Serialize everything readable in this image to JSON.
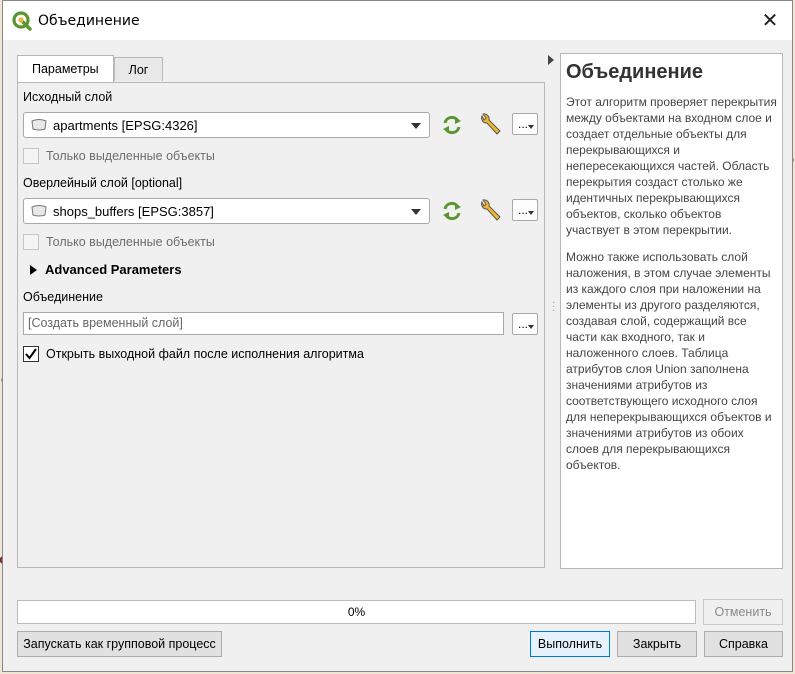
{
  "window": {
    "title": "Объединение"
  },
  "tabs": [
    {
      "label": "Параметры"
    },
    {
      "label": "Лог"
    }
  ],
  "params": {
    "input_label": "Исходный слой",
    "input_value": "apartments [EPSG:4326]",
    "input_selected_only": "Только выделенные объекты",
    "overlay_label": "Оверлейный слой [optional]",
    "overlay_value": "shops_buffers [EPSG:3857]",
    "overlay_selected_only": "Только выделенные объекты",
    "advanced_label": "Advanced Parameters",
    "output_label": "Объединение",
    "output_placeholder": "[Создать временный слой]",
    "open_output_label": "Открыть выходной файл после исполнения алгоритма",
    "open_output_checked": true,
    "dots": "..."
  },
  "help": {
    "title": "Объединение",
    "p1": "Этот алгоритм проверяет перекрытия между объектами на входном слое и создает отдельные объекты для перекрывающихся и непересекающихся частей. Область перекрытия создаст столько же идентичных перекрывающихся объектов, сколько объектов участвует в этом перекрытии.",
    "p2": "Можно также использовать слой наложения, в этом случае элементы из каждого слоя при наложении на элементы из другого разделяются, создавая слой, содержащий все части как входного, так и наложенного слоев. Таблица атрибутов слоя Union заполнена значениями атрибутов из соответствующего исходного слоя для неперекрывающихся объектов и значениями атрибутов из обоих слоев для перекрывающихся объектов."
  },
  "progress": {
    "value": 0,
    "label": "0%"
  },
  "buttons": {
    "cancel": "Отменить",
    "batch": "Запускать как групповой процесс",
    "run": "Выполнить",
    "close": "Закрыть",
    "help": "Справка"
  },
  "colors": {
    "accent": "#0078d7",
    "qgis_green": "#589632",
    "qgis_yellow": "#f0b62d"
  }
}
